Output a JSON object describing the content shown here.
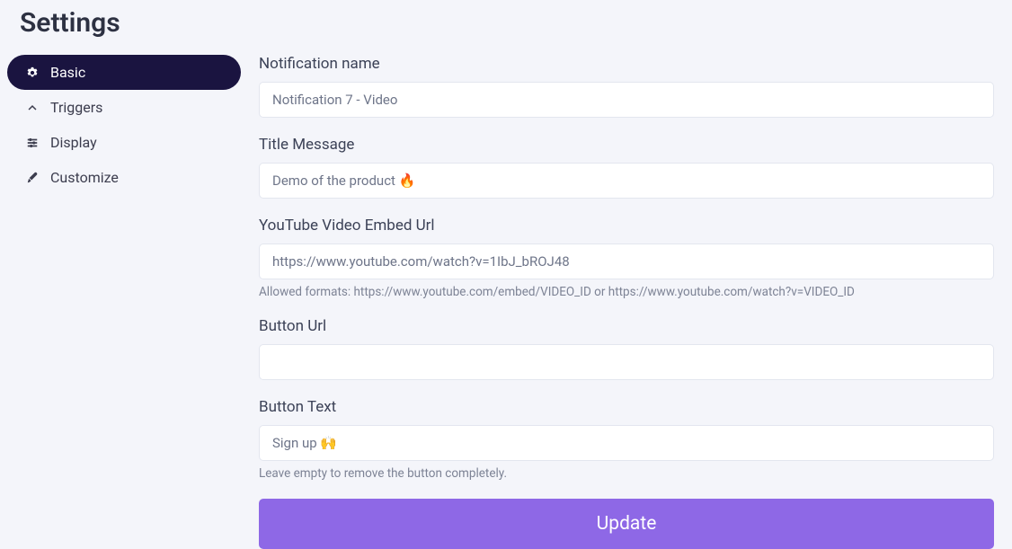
{
  "page_title": "Settings",
  "sidebar": {
    "items": [
      {
        "label": "Basic"
      },
      {
        "label": "Triggers"
      },
      {
        "label": "Display"
      },
      {
        "label": "Customize"
      }
    ]
  },
  "form": {
    "notification_name": {
      "label": "Notification name",
      "value": "Notification 7 - Video"
    },
    "title_message": {
      "label": "Title Message",
      "value": "Demo of the product 🔥"
    },
    "youtube_url": {
      "label": "YouTube Video Embed Url",
      "value": "https://www.youtube.com/watch?v=1IbJ_bROJ48",
      "help": "Allowed formats: https://www.youtube.com/embed/VIDEO_ID or https://www.youtube.com/watch?v=VIDEO_ID"
    },
    "button_url": {
      "label": "Button Url",
      "value": ""
    },
    "button_text": {
      "label": "Button Text",
      "value": "Sign up 🙌",
      "help": "Leave empty to remove the button completely."
    },
    "submit_label": "Update"
  }
}
